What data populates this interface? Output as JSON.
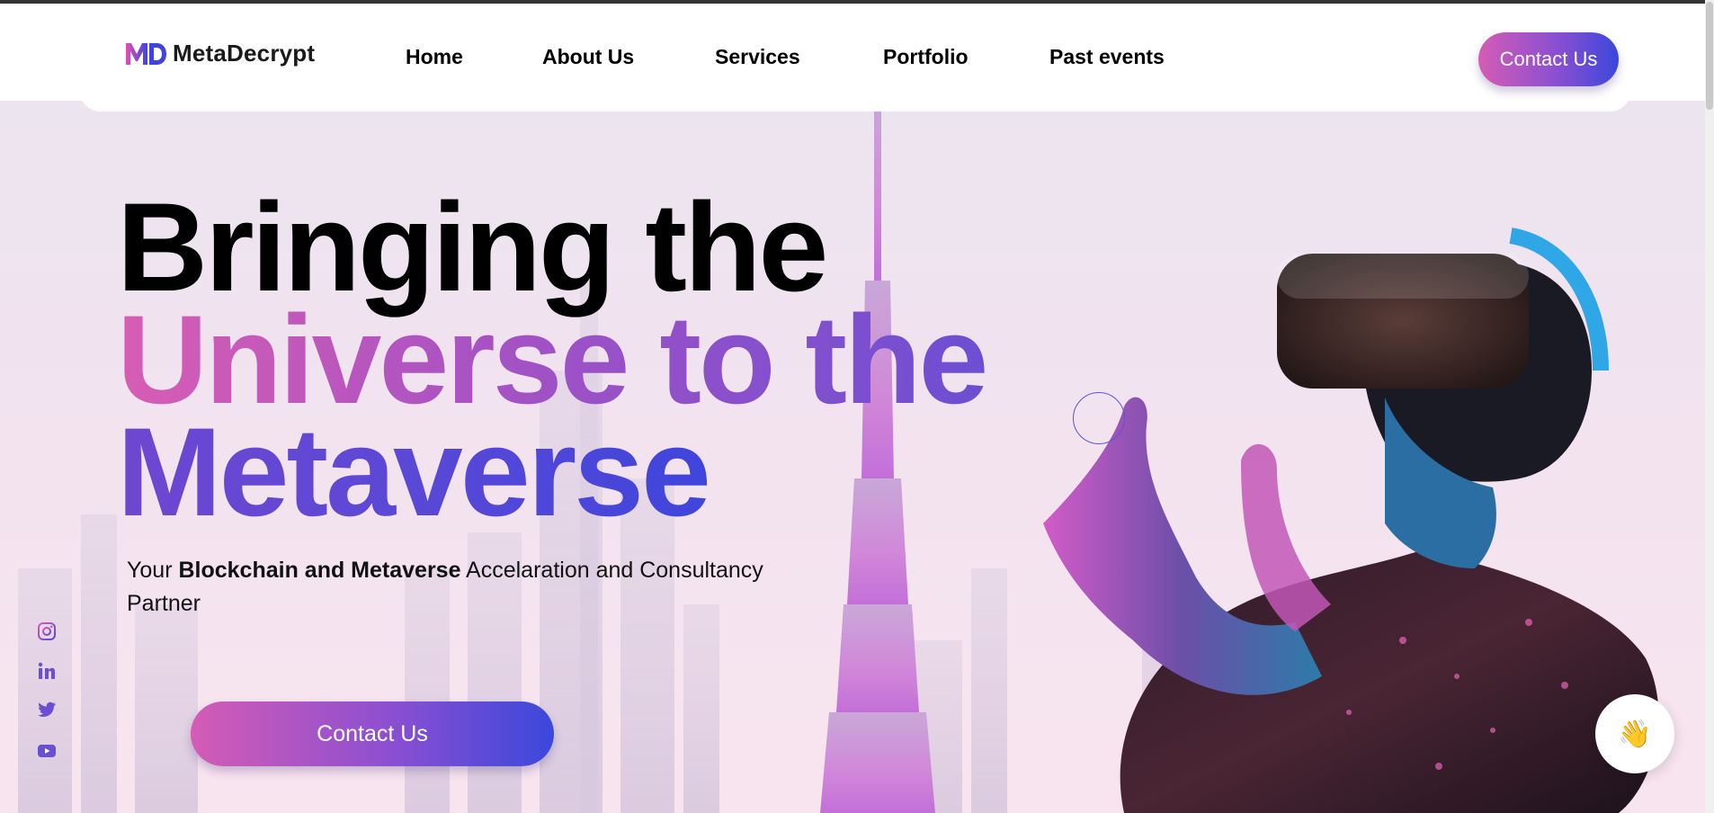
{
  "brand": {
    "name": "MetaDecrypt",
    "mark": "MD"
  },
  "nav": {
    "items": [
      {
        "label": "Home"
      },
      {
        "label": "About Us"
      },
      {
        "label": "Services"
      },
      {
        "label": "Portfolio"
      },
      {
        "label": "Past events"
      }
    ],
    "cta": "Contact Us"
  },
  "hero": {
    "line1": "Bringing the",
    "line2": "Universe to the",
    "line3": "Metaverse",
    "subtitle_pre": "Your ",
    "subtitle_bold": "Blockchain and Metaverse",
    "subtitle_post": " Accelaration and Consultancy Partner",
    "cta": "Contact Us"
  },
  "social": [
    "instagram-icon",
    "linkedin-icon",
    "twitter-icon",
    "youtube-icon"
  ],
  "chat_widget": {
    "emoji": "👋"
  },
  "colors": {
    "gradient_start": "#d45cb5",
    "gradient_end": "#3a48dc",
    "accent_purple": "#6d4ed3"
  }
}
